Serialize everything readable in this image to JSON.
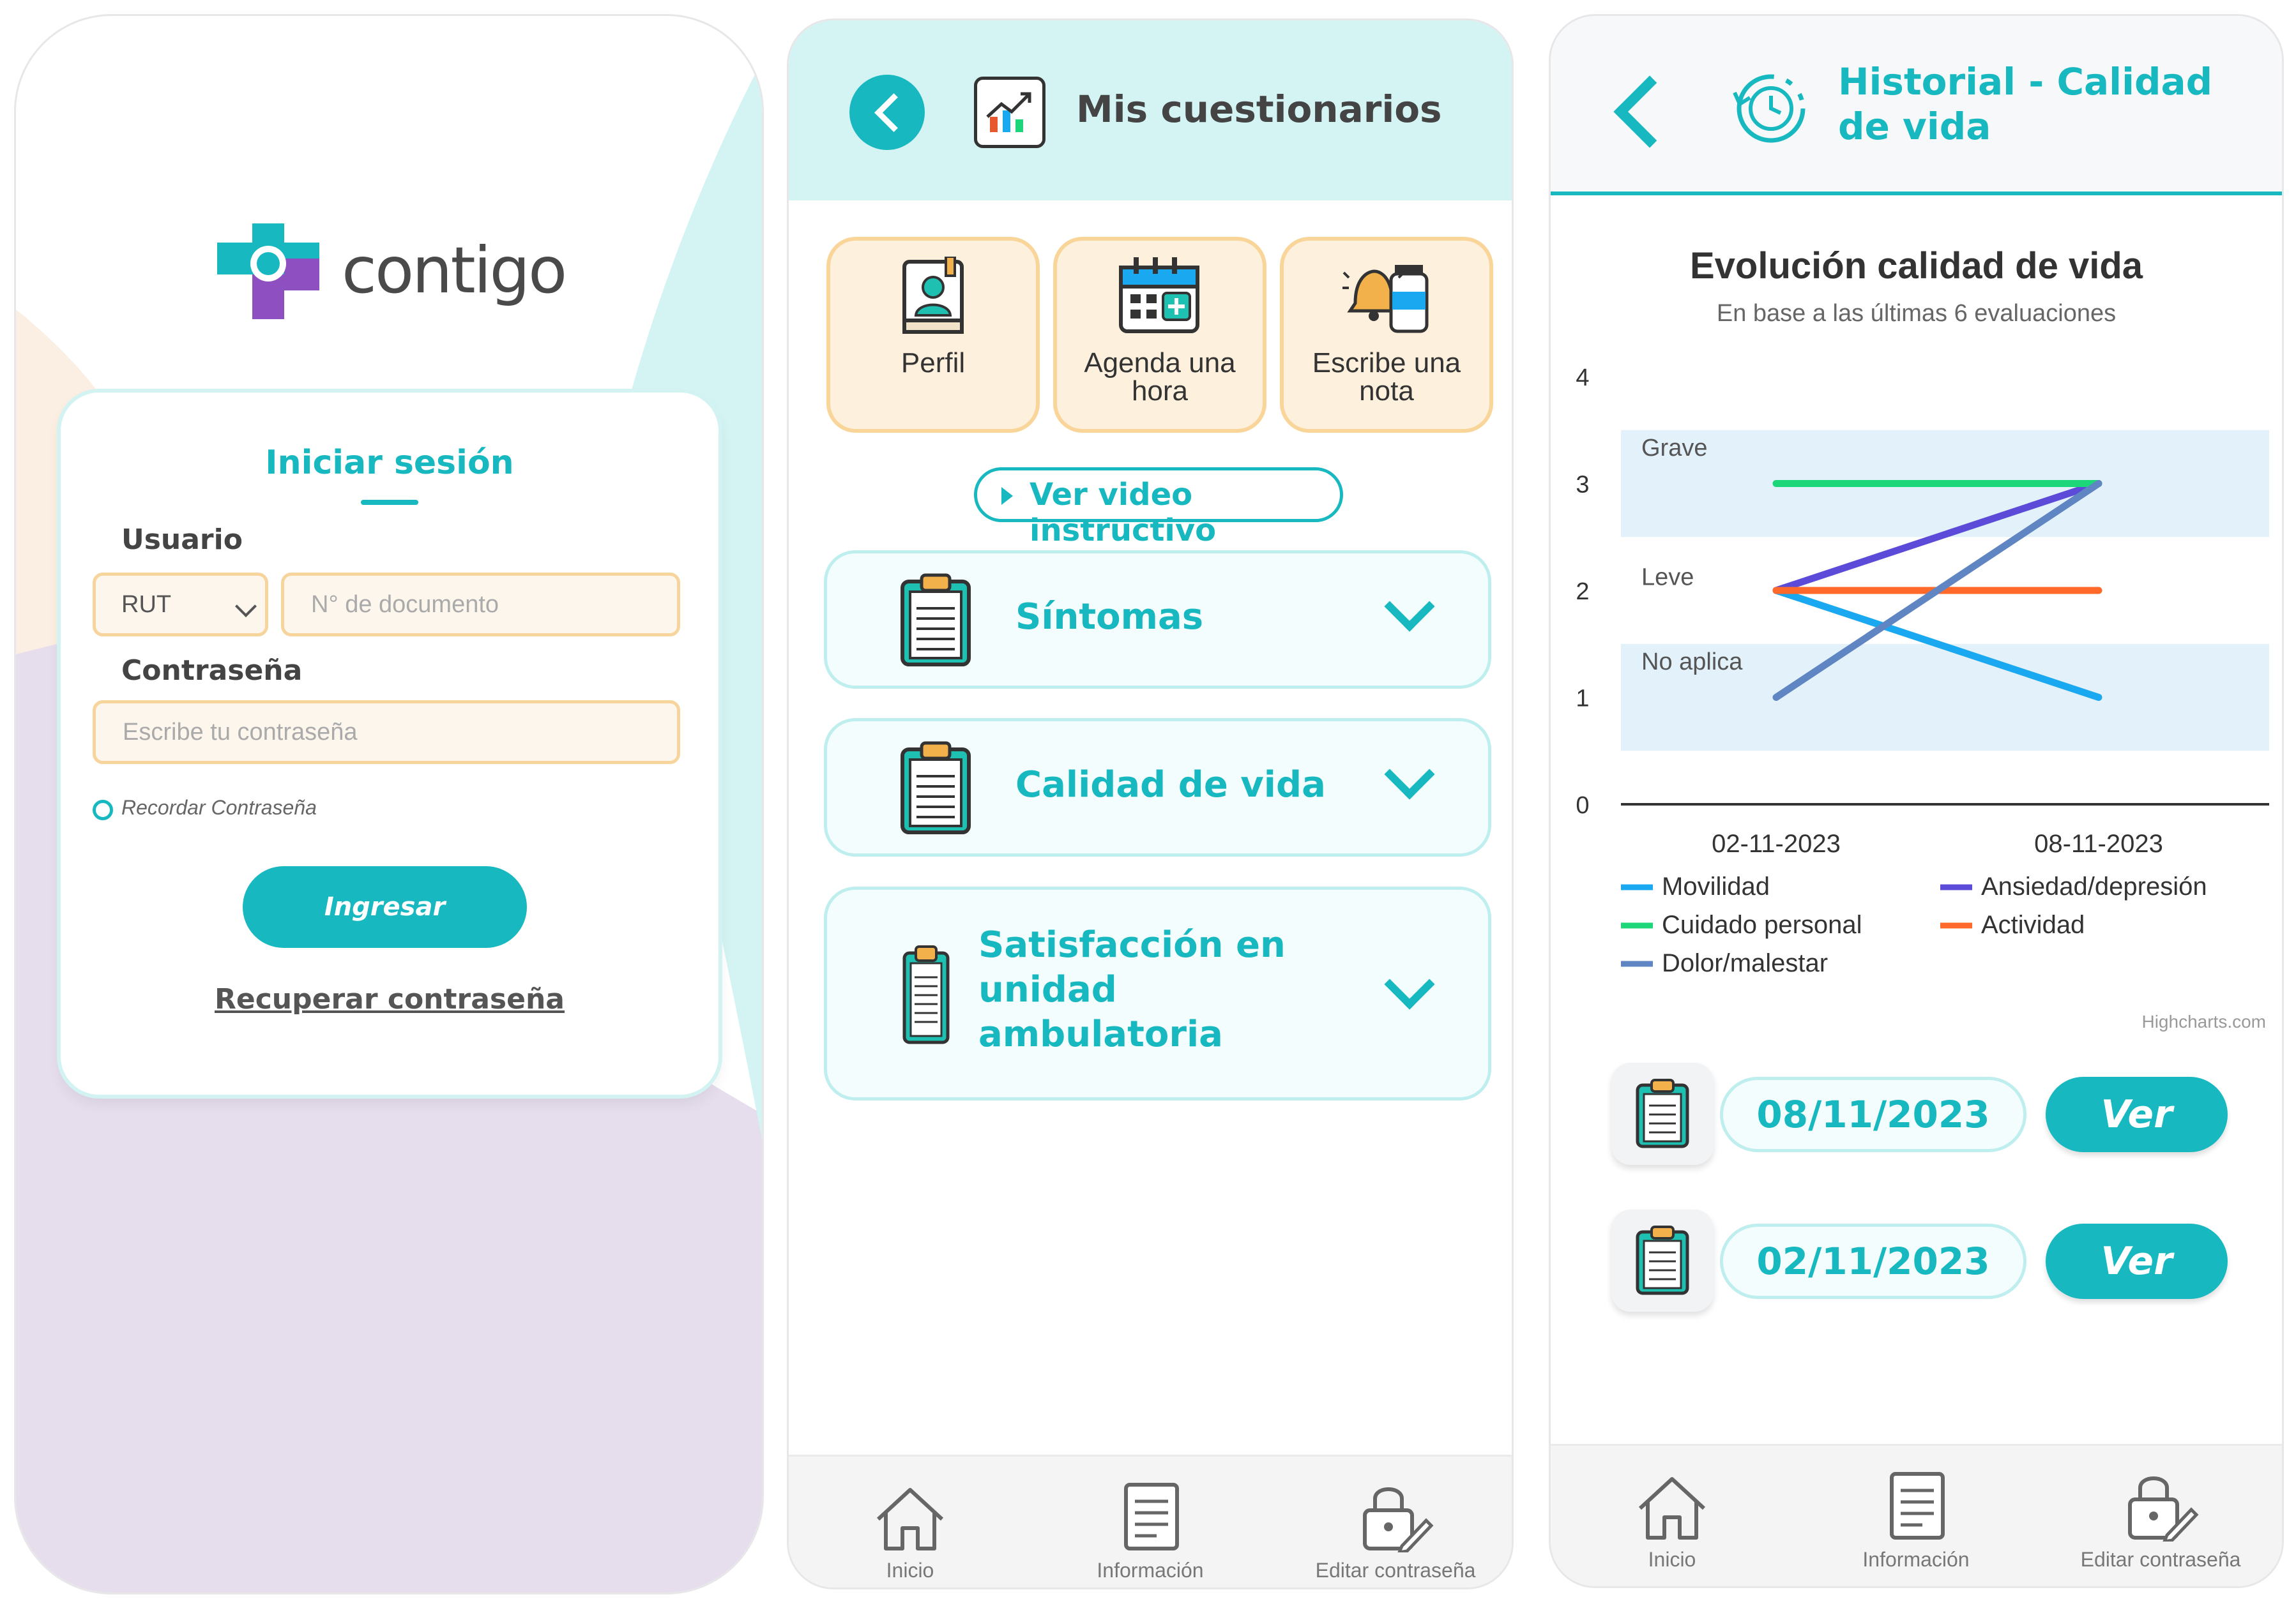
{
  "login": {
    "brand": "contigo",
    "title": "Iniciar sesión",
    "user_label": "Usuario",
    "doc_type": "RUT",
    "doc_placeholder": "N° de documento",
    "password_label": "Contraseña",
    "password_placeholder": "Escribe tu contraseña",
    "remember_label": "Recordar Contraseña",
    "login_button": "Ingresar",
    "recover_link": "Recuperar contraseña"
  },
  "questionnaires": {
    "title": "Mis cuestionarios",
    "tiles": [
      {
        "label": "Perfil",
        "icon": "profile-book-icon"
      },
      {
        "label": "Agenda una hora",
        "icon": "calendar-add-icon"
      },
      {
        "label": "Escribe una nota",
        "icon": "bell-bottle-icon"
      }
    ],
    "video_button": "Ver video instructivo",
    "sections": [
      {
        "label": "Síntomas",
        "icon": "clipboard-icon"
      },
      {
        "label": "Calidad de vida",
        "icon": "clipboard-icon"
      },
      {
        "label": "Satisfacción en unidad ambulatoria",
        "icon": "clipboard-icon"
      }
    ]
  },
  "history": {
    "title": "Historial - Calidad de vida",
    "credit": "Highcharts.com",
    "records": [
      {
        "date": "08/11/2023",
        "button": "Ver"
      },
      {
        "date": "02/11/2023",
        "button": "Ver"
      }
    ]
  },
  "nav": {
    "home": "Inicio",
    "info": "Información",
    "password": "Editar contraseña"
  },
  "colors": {
    "accent": "#18b8c0",
    "tile_border": "#f9d59a",
    "login_bg_purple": "#e6deed",
    "login_bg_teal": "#d4f3f3"
  },
  "chart_data": {
    "type": "line",
    "title": "Evolución calidad de vida",
    "subtitle": "En base a las últimas 6 evaluaciones",
    "categories": [
      "02-11-2023",
      "08-11-2023"
    ],
    "ylim": [
      0,
      4
    ],
    "yticks": [
      0,
      1,
      2,
      3,
      4
    ],
    "bands": [
      {
        "label": "Grave",
        "from": 2.5,
        "to": 3.5
      },
      {
        "label": "Leve",
        "from": 1.5,
        "to": 2.5
      },
      {
        "label": "No aplica",
        "from": 0.5,
        "to": 1.5
      }
    ],
    "series": [
      {
        "name": "Movilidad",
        "values": [
          2,
          1
        ],
        "color": "#1aa9f0"
      },
      {
        "name": "Ansiedad/depresión",
        "values": [
          2,
          3
        ],
        "color": "#5b4bd8"
      },
      {
        "name": "Cuidado personal",
        "values": [
          3,
          3
        ],
        "color": "#1ed67a"
      },
      {
        "name": "Actividad",
        "values": [
          2,
          2
        ],
        "color": "#ff6a2a"
      },
      {
        "name": "Dolor/malestar",
        "values": [
          1,
          3
        ],
        "color": "#5f86c2"
      }
    ],
    "legend": "bottom",
    "grid": false
  }
}
